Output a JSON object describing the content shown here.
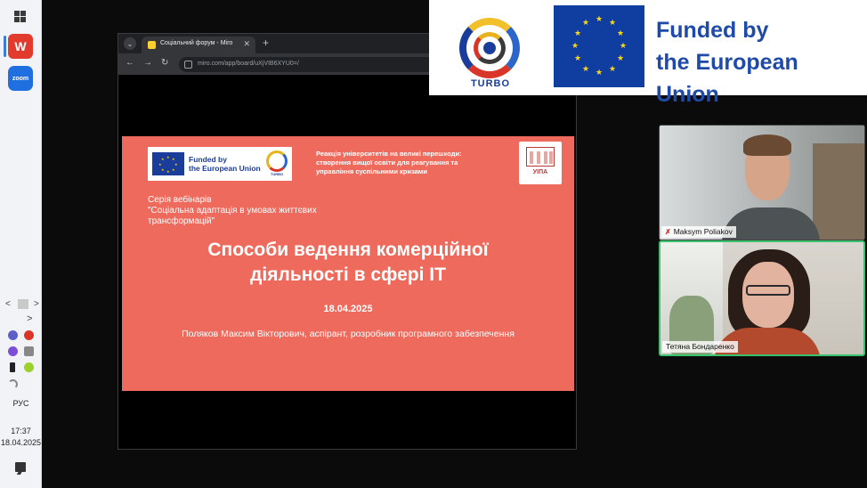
{
  "taskbar": {
    "apps": [
      {
        "name": "windows-start",
        "glyph": ""
      },
      {
        "name": "wps-office",
        "glyph": "W"
      },
      {
        "name": "zoom",
        "glyph": "zoom"
      }
    ],
    "tray_left_arrow": "<",
    "tray_right_arrow": ">",
    "tray_more": ">",
    "language": "РУС",
    "time": "17:37",
    "date": "18.04.2025"
  },
  "browser": {
    "tab_title": "Соціальний форум - Miro",
    "tab_close": "✕",
    "tab_down": "⌄",
    "new_tab": "+",
    "back": "←",
    "forward": "→",
    "reload": "↻",
    "url": "miro.com/app/board/uXjVIB6XYU0=/"
  },
  "slide": {
    "eu_funded_line1": "Funded by",
    "eu_funded_line2": "the European Union",
    "turbo_label": "TURBO",
    "header_line1": "Реакція університетів на великі перешкоди:",
    "header_line2": "створення вищої освіти для реагування та",
    "header_line3": "управління суспільними кризами",
    "uipa_label": "УІПА",
    "series_line1": "Серія вебінарів",
    "series_line2": "\"Соціальна адаптація в умовах життєвих",
    "series_line3": "трансформацій\"",
    "title_line1": "Способи ведення комерційної",
    "title_line2": "діяльності в сфері IT",
    "date": "18.04.2025",
    "author": "Поляков Максим Вікторович, аспірант, розробник програмного забезпечення"
  },
  "banner": {
    "turbo_label": "TURBO",
    "funded_line1": "Funded by",
    "funded_line2": "the European Union"
  },
  "participants": [
    {
      "name": "Maksym Poliakov",
      "muted": true,
      "mute_glyph": "✗"
    },
    {
      "name": "Тетяна Бондаренко",
      "muted": false,
      "speaking": true
    }
  ],
  "colors": {
    "slide_bg": "#ee6a5c",
    "eu_blue": "#0f3da0",
    "eu_star": "#ffd617",
    "funded_text": "#1f4aa8",
    "speaking_border": "#38c26b"
  }
}
